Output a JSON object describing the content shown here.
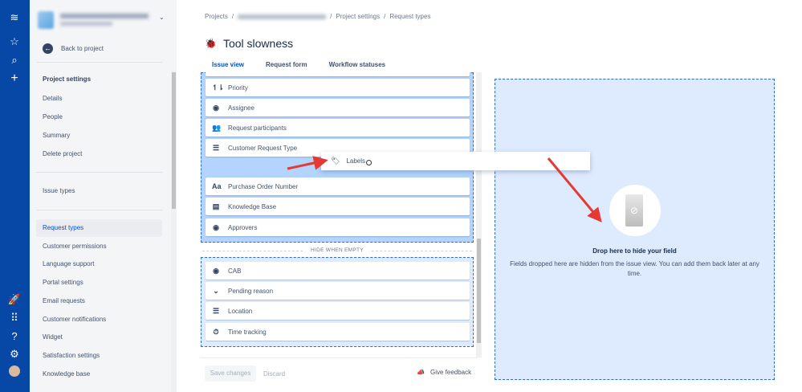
{
  "sidebar": {
    "back": "Back to project",
    "section": "Project settings",
    "items": [
      "Details",
      "People",
      "Summary",
      "Delete project"
    ],
    "issue_types": "Issue types",
    "items2": [
      "Request types",
      "Customer permissions",
      "Language support",
      "Portal settings",
      "Email requests",
      "Customer notifications",
      "Widget",
      "Satisfaction settings",
      "Knowledge base"
    ]
  },
  "breadcrumb": {
    "projects": "Projects",
    "sep": "/",
    "project_settings": "Project settings",
    "request_types": "Request types"
  },
  "page": {
    "title": "Tool slowness"
  },
  "tabs": [
    "Issue view",
    "Request form",
    "Workflow statuses"
  ],
  "visible_fields": [
    {
      "label": "Priority",
      "icon": "↿⇂"
    },
    {
      "label": "Assignee",
      "icon": "◉"
    },
    {
      "label": "Request participants",
      "icon": "👥"
    },
    {
      "label": "Customer Request Type",
      "icon": "☰"
    },
    {
      "label": "Purchase Order Number",
      "icon": "Aa"
    },
    {
      "label": "Knowledge Base",
      "icon": "▤"
    },
    {
      "label": "Approvers",
      "icon": "◉"
    }
  ],
  "hide_when_empty": "HIDE WHEN EMPTY",
  "hidden_when_empty_fields": [
    {
      "label": "CAB",
      "icon": "◉"
    },
    {
      "label": "Pending reason",
      "icon": "⌄"
    },
    {
      "label": "Location",
      "icon": "☰"
    },
    {
      "label": "Time tracking",
      "icon": "⏱"
    }
  ],
  "dragging": {
    "label": "Labels",
    "icon": "🏷"
  },
  "dropzone": {
    "heading": "Drop here to hide your field",
    "description": "Fields dropped here are hidden from the issue view. You can add them back later at any time."
  },
  "footer": {
    "save": "Save changes",
    "discard": "Discard",
    "feedback": "Give feedback"
  },
  "colors": {
    "nav": "#0747a6",
    "accent": "#0052cc",
    "annotation": "#e53935"
  }
}
